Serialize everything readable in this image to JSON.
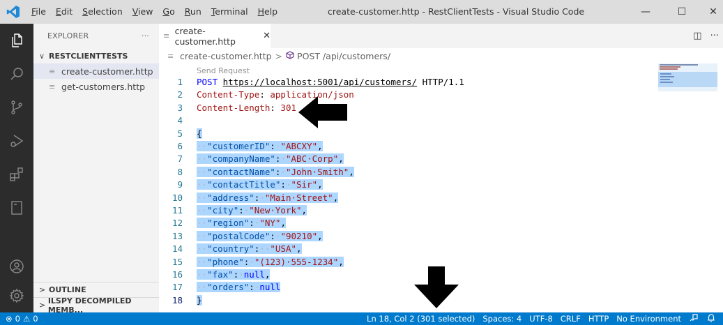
{
  "titlebar": {
    "window_title": "create-customer.http - RestClientTests - Visual Studio Code",
    "menu": [
      {
        "label": "File",
        "u": "F",
        "rest": "ile"
      },
      {
        "label": "Edit",
        "u": "E",
        "rest": "dit"
      },
      {
        "label": "Selection",
        "u": "S",
        "rest": "election"
      },
      {
        "label": "View",
        "u": "V",
        "rest": "iew"
      },
      {
        "label": "Go",
        "u": "G",
        "rest": "o"
      },
      {
        "label": "Run",
        "u": "R",
        "rest": "un"
      },
      {
        "label": "Terminal",
        "u": "T",
        "rest": "erminal"
      },
      {
        "label": "Help",
        "u": "H",
        "rest": "elp"
      }
    ],
    "minimize": "—",
    "maximize": "☐",
    "close": "✕"
  },
  "activity_bar": {
    "icons": [
      "explorer-icon",
      "search-icon",
      "source-control-icon",
      "run-debug-icon",
      "extensions-icon",
      "notebook-icon",
      "accounts-icon",
      "settings-gear-icon"
    ]
  },
  "sidebar": {
    "title": "EXPLORER",
    "more": "···",
    "folder": "RESTCLIENTTESTS",
    "files": [
      "create-customer.http",
      "get-customers.http"
    ],
    "outline": "OUTLINE",
    "ilspy": "ILSPY DECOMPILED MEMB..."
  },
  "tab": {
    "label": "create-customer.http",
    "close": "✕",
    "split": "◫",
    "more": "···"
  },
  "breadcrumb": {
    "file": "create-customer.http",
    "separator": ">",
    "symbol": "POST /api/customers/"
  },
  "editor": {
    "codelens": "Send Request",
    "lines": [
      {
        "n": "1",
        "parts": [
          [
            "kw",
            "POST"
          ],
          [
            "plain",
            " "
          ],
          [
            "url",
            "https://localhost:5001/api/customers/"
          ],
          [
            "plain",
            " HTTP/1.1"
          ]
        ]
      },
      {
        "n": "2",
        "parts": [
          [
            "hdrname",
            "Content-Type"
          ],
          [
            "plain",
            ": "
          ],
          [
            "hdrval",
            "application/json"
          ]
        ]
      },
      {
        "n": "3",
        "parts": [
          [
            "hdrname",
            "Content-Length"
          ],
          [
            "plain",
            ": "
          ],
          [
            "hdrval",
            "301"
          ]
        ]
      },
      {
        "n": "4",
        "parts": []
      },
      {
        "n": "5",
        "sel": true,
        "parts": [
          [
            "brace",
            "{"
          ]
        ]
      },
      {
        "n": "6",
        "sel": true,
        "parts": [
          [
            "ws",
            "··"
          ],
          [
            "key",
            "\"customerID\""
          ],
          [
            "plain",
            ":"
          ],
          [
            "ws",
            "·"
          ],
          [
            "str",
            "\"ABCXY\""
          ],
          [
            "plain",
            ","
          ]
        ]
      },
      {
        "n": "7",
        "sel": true,
        "parts": [
          [
            "ws",
            "··"
          ],
          [
            "key",
            "\"companyName\""
          ],
          [
            "plain",
            ":"
          ],
          [
            "ws",
            "·"
          ],
          [
            "str",
            "\"ABC·Corp\""
          ],
          [
            "plain",
            ","
          ]
        ]
      },
      {
        "n": "8",
        "sel": true,
        "parts": [
          [
            "ws",
            "··"
          ],
          [
            "key",
            "\"contactName\""
          ],
          [
            "plain",
            ":"
          ],
          [
            "ws",
            "·"
          ],
          [
            "str",
            "\"John·Smith\""
          ],
          [
            "plain",
            ","
          ]
        ]
      },
      {
        "n": "9",
        "sel": true,
        "parts": [
          [
            "ws",
            "··"
          ],
          [
            "key",
            "\"contactTitle\""
          ],
          [
            "plain",
            ":"
          ],
          [
            "ws",
            "·"
          ],
          [
            "str",
            "\"Sir\""
          ],
          [
            "plain",
            ","
          ]
        ]
      },
      {
        "n": "10",
        "sel": true,
        "parts": [
          [
            "ws",
            "··"
          ],
          [
            "key",
            "\"address\""
          ],
          [
            "plain",
            ":"
          ],
          [
            "ws",
            "·"
          ],
          [
            "str",
            "\"Main·Street\""
          ],
          [
            "plain",
            ","
          ]
        ]
      },
      {
        "n": "11",
        "sel": true,
        "parts": [
          [
            "ws",
            "··"
          ],
          [
            "key",
            "\"city\""
          ],
          [
            "plain",
            ":"
          ],
          [
            "ws",
            "·"
          ],
          [
            "str",
            "\"New·York\""
          ],
          [
            "plain",
            ","
          ]
        ]
      },
      {
        "n": "12",
        "sel": true,
        "parts": [
          [
            "ws",
            "··"
          ],
          [
            "key",
            "\"region\""
          ],
          [
            "plain",
            ":"
          ],
          [
            "ws",
            "·"
          ],
          [
            "str",
            "\"NY\""
          ],
          [
            "plain",
            ","
          ]
        ]
      },
      {
        "n": "13",
        "sel": true,
        "parts": [
          [
            "ws",
            "··"
          ],
          [
            "key",
            "\"postalCode\""
          ],
          [
            "plain",
            ":"
          ],
          [
            "ws",
            "·"
          ],
          [
            "str",
            "\"90210\""
          ],
          [
            "plain",
            ","
          ]
        ]
      },
      {
        "n": "14",
        "sel": true,
        "parts": [
          [
            "ws",
            "··"
          ],
          [
            "key",
            "\"country\""
          ],
          [
            "plain",
            ":"
          ],
          [
            "ws",
            "··"
          ],
          [
            "str",
            "\"USA\""
          ],
          [
            "plain",
            ","
          ]
        ]
      },
      {
        "n": "15",
        "sel": true,
        "parts": [
          [
            "ws",
            "··"
          ],
          [
            "key",
            "\"phone\""
          ],
          [
            "plain",
            ":"
          ],
          [
            "ws",
            "·"
          ],
          [
            "str",
            "\"(123)·555-1234\""
          ],
          [
            "plain",
            ","
          ]
        ]
      },
      {
        "n": "16",
        "sel": true,
        "parts": [
          [
            "ws",
            "··"
          ],
          [
            "key",
            "\"fax\""
          ],
          [
            "plain",
            ":"
          ],
          [
            "ws",
            "·"
          ],
          [
            "null",
            "null"
          ],
          [
            "plain",
            ","
          ]
        ]
      },
      {
        "n": "17",
        "sel": true,
        "parts": [
          [
            "ws",
            "··"
          ],
          [
            "key",
            "\"orders\""
          ],
          [
            "plain",
            ":"
          ],
          [
            "ws",
            "·"
          ],
          [
            "null",
            "null"
          ]
        ]
      },
      {
        "n": "18",
        "sel": true,
        "current": true,
        "parts": [
          [
            "brace",
            "}"
          ]
        ]
      }
    ]
  },
  "statusbar": {
    "errors": "0",
    "warnings": "0",
    "error_icon": "⊗",
    "warning_icon": "⚠",
    "items": [
      "Ln 18, Col 2 (301 selected)",
      "Spaces: 4",
      "UTF-8",
      "CRLF",
      "HTTP",
      "No Environment"
    ],
    "feedback_icon": "feedback-icon",
    "bell_icon": "bell-icon"
  },
  "colors": {
    "accent": "#007acc",
    "activity_bar": "#2c2c2c",
    "selection": "#add6ff"
  }
}
